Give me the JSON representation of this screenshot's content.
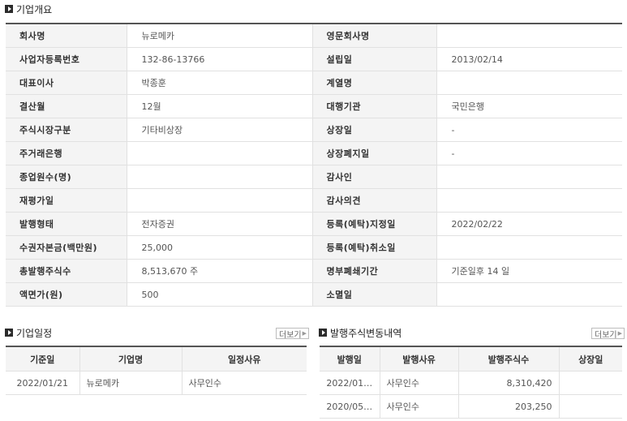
{
  "overview": {
    "title": "기업개요",
    "rows": [
      {
        "l1": "회사명",
        "v1": "뉴로메카",
        "l2": "영문회사명",
        "v2": ""
      },
      {
        "l1": "사업자등록번호",
        "v1": "132-86-13766",
        "l2": "설립일",
        "v2": "2013/02/14"
      },
      {
        "l1": "대표이사",
        "v1": "박종훈",
        "l2": "계열명",
        "v2": ""
      },
      {
        "l1": "결산월",
        "v1": "12월",
        "l2": "대행기관",
        "v2": "국민은행"
      },
      {
        "l1": "주식시장구분",
        "v1": "기타비상장",
        "l2": "상장일",
        "v2": "-"
      },
      {
        "l1": "주거래은행",
        "v1": "",
        "l2": "상장폐지일",
        "v2": "-"
      },
      {
        "l1": "종업원수(명)",
        "v1": "",
        "l2": "감사인",
        "v2": ""
      },
      {
        "l1": "재평가일",
        "v1": "",
        "l2": "감사의견",
        "v2": ""
      },
      {
        "l1": "발행형태",
        "v1": "전자증권",
        "l2": "등록(예탁)지정일",
        "v2": "2022/02/22"
      },
      {
        "l1": "수권자본금(백만원)",
        "v1": "25,000",
        "l2": "등록(예탁)취소일",
        "v2": ""
      },
      {
        "l1": "총발행주식수",
        "v1": "8,513,670 주",
        "l2": "명부폐쇄기간",
        "v2": "기준일후 14 일"
      },
      {
        "l1": "액면가(원)",
        "v1": "500",
        "l2": "소멸일",
        "v2": ""
      }
    ]
  },
  "schedule": {
    "title": "기업일정",
    "more": "더보기",
    "headers": [
      "기준일",
      "기업명",
      "일정사유"
    ],
    "rows": [
      [
        "2022/01/21",
        "뉴로메카",
        "사무인수"
      ]
    ]
  },
  "shares": {
    "title": "발행주식변동내역",
    "more": "더보기",
    "headers": [
      "발행일",
      "발행사유",
      "발행주식수",
      "상장일"
    ],
    "rows": [
      [
        "2022/01…",
        "사무인수",
        "8,310,420",
        ""
      ],
      [
        "2020/05…",
        "사무인수",
        "203,250",
        ""
      ]
    ]
  }
}
